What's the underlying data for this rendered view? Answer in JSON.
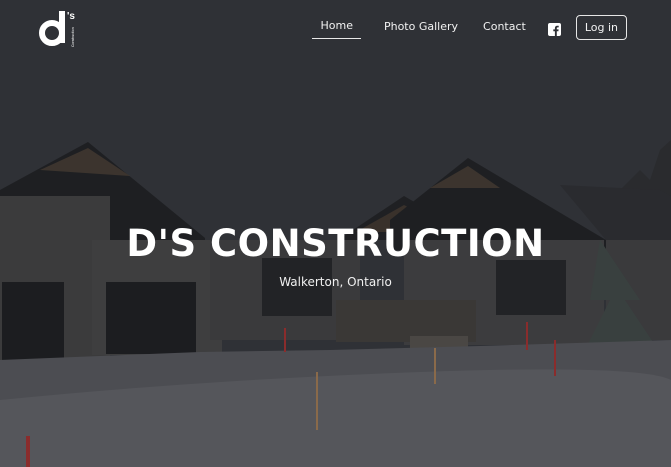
{
  "brand": {
    "logo_letter": "d",
    "logo_superscript": "'s",
    "logo_small_text": "Construction"
  },
  "nav": {
    "items": [
      {
        "label": "Home",
        "active": true
      },
      {
        "label": "Photo Gallery",
        "active": false
      },
      {
        "label": "Contact",
        "active": false
      }
    ],
    "social_icon": "facebook-icon",
    "login_label": "Log in"
  },
  "hero": {
    "title": "D'S CONSTRUCTION",
    "subtitle": "Walkerton, Ontario"
  },
  "colors": {
    "overlay": "#2e3035",
    "text": "#ffffff"
  }
}
